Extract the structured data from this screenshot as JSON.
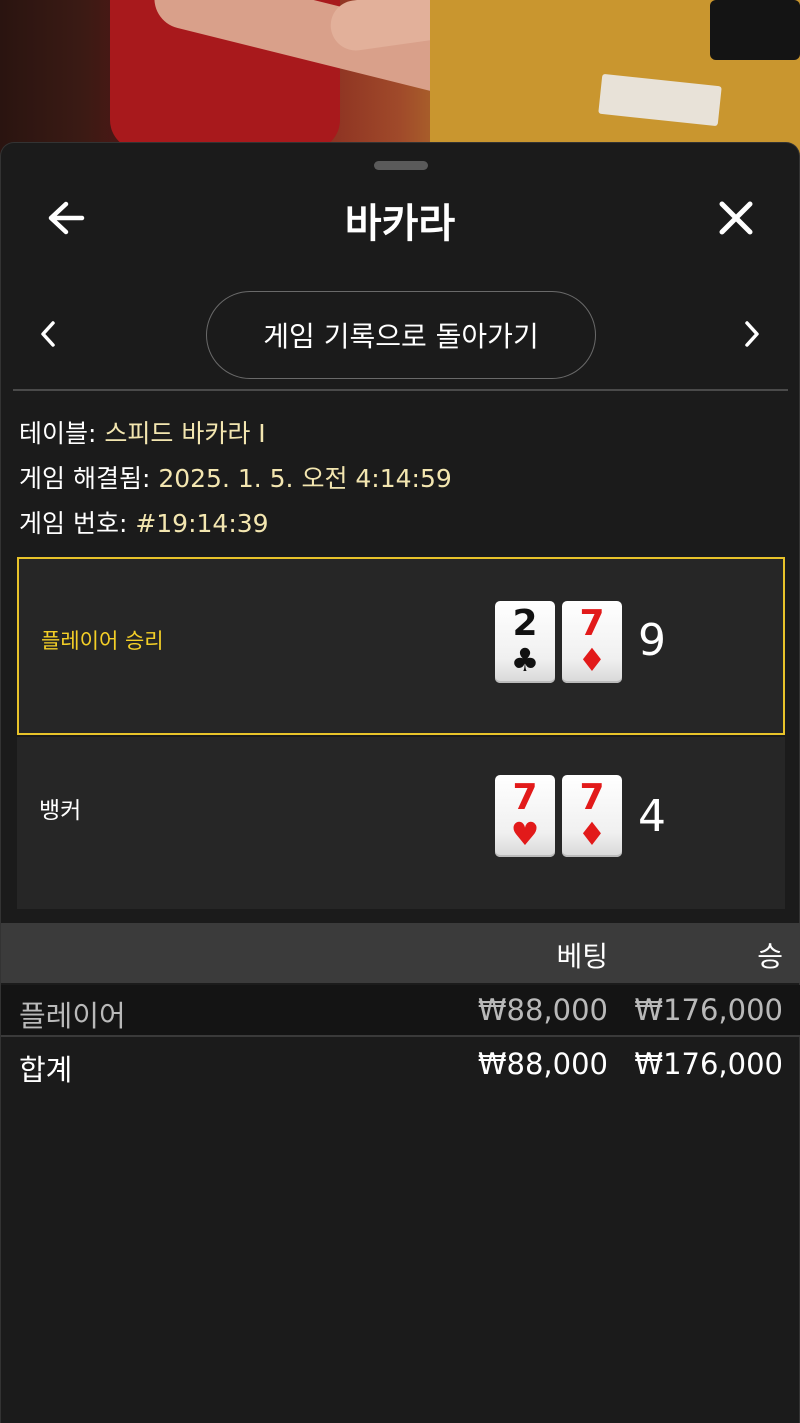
{
  "header": {
    "title": "바카라"
  },
  "nav": {
    "history_label": "게임 기록으로 돌아가기"
  },
  "info": {
    "table_label": "테이블: ",
    "table_value": "스피드 바카라 I",
    "resolved_label": "게임 해결됨: ",
    "resolved_value": "2025. 1. 5. 오전 4:14:59",
    "game_no_label": "게임 번호: ",
    "game_no_value": "#19:14:39"
  },
  "results": {
    "player": {
      "label": "플레이어 승리",
      "score": "9",
      "cards": [
        {
          "rank": "2",
          "suit": "♣",
          "color": "black"
        },
        {
          "rank": "7",
          "suit": "♦",
          "color": "red"
        }
      ]
    },
    "banker": {
      "label": "뱅커",
      "score": "4",
      "cards": [
        {
          "rank": "7",
          "suit": "♥",
          "color": "red"
        },
        {
          "rank": "7",
          "suit": "♦",
          "color": "red"
        }
      ]
    }
  },
  "bets_table": {
    "columns": [
      "베팅",
      "승"
    ],
    "rows": [
      {
        "name": "플레이어",
        "bet": "₩88,000",
        "win": "₩176,000"
      }
    ],
    "total": {
      "name": "합계",
      "bet": "₩88,000",
      "win": "₩176,000"
    }
  },
  "colors": {
    "accent_gold": "#e8c32a",
    "info_value": "#f3e6b0",
    "card_red": "#e21a1a",
    "background": "#1b1b1b"
  },
  "icons": [
    "arrow-left-icon",
    "close-icon",
    "chevron-left-icon",
    "chevron-right-icon"
  ]
}
